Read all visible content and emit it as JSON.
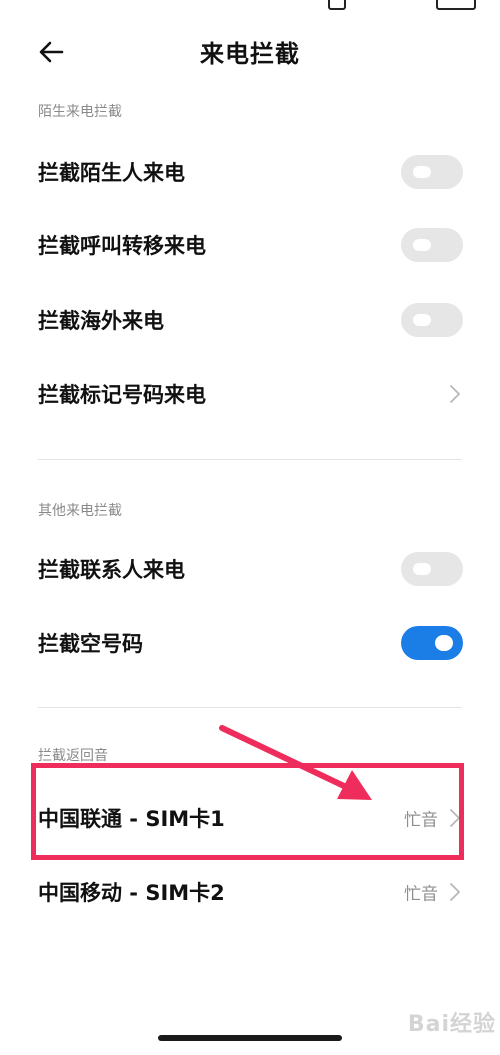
{
  "header": {
    "title": "来电拦截"
  },
  "sections": [
    {
      "title": "陌生来电拦截"
    },
    {
      "title": "其他来电拦截"
    },
    {
      "title": "拦截返回音"
    }
  ],
  "rows": {
    "stranger": {
      "label": "拦截陌生人来电",
      "enabled": false
    },
    "forwarded": {
      "label": "拦截呼叫转移来电",
      "enabled": false
    },
    "overseas": {
      "label": "拦截海外来电",
      "enabled": false
    },
    "marked": {
      "label": "拦截标记号码来电"
    },
    "contacts": {
      "label": "拦截联系人来电",
      "enabled": false
    },
    "empty": {
      "label": "拦截空号码",
      "enabled": true
    },
    "sim1": {
      "label": "中国联通 - SIM卡1",
      "value": "忙音"
    },
    "sim2": {
      "label": "中国移动 - SIM卡2",
      "value": "忙音"
    }
  },
  "colors": {
    "accent": "#1a7ee6",
    "annotation": "#ef2d5c"
  },
  "watermark": "Bai经验"
}
